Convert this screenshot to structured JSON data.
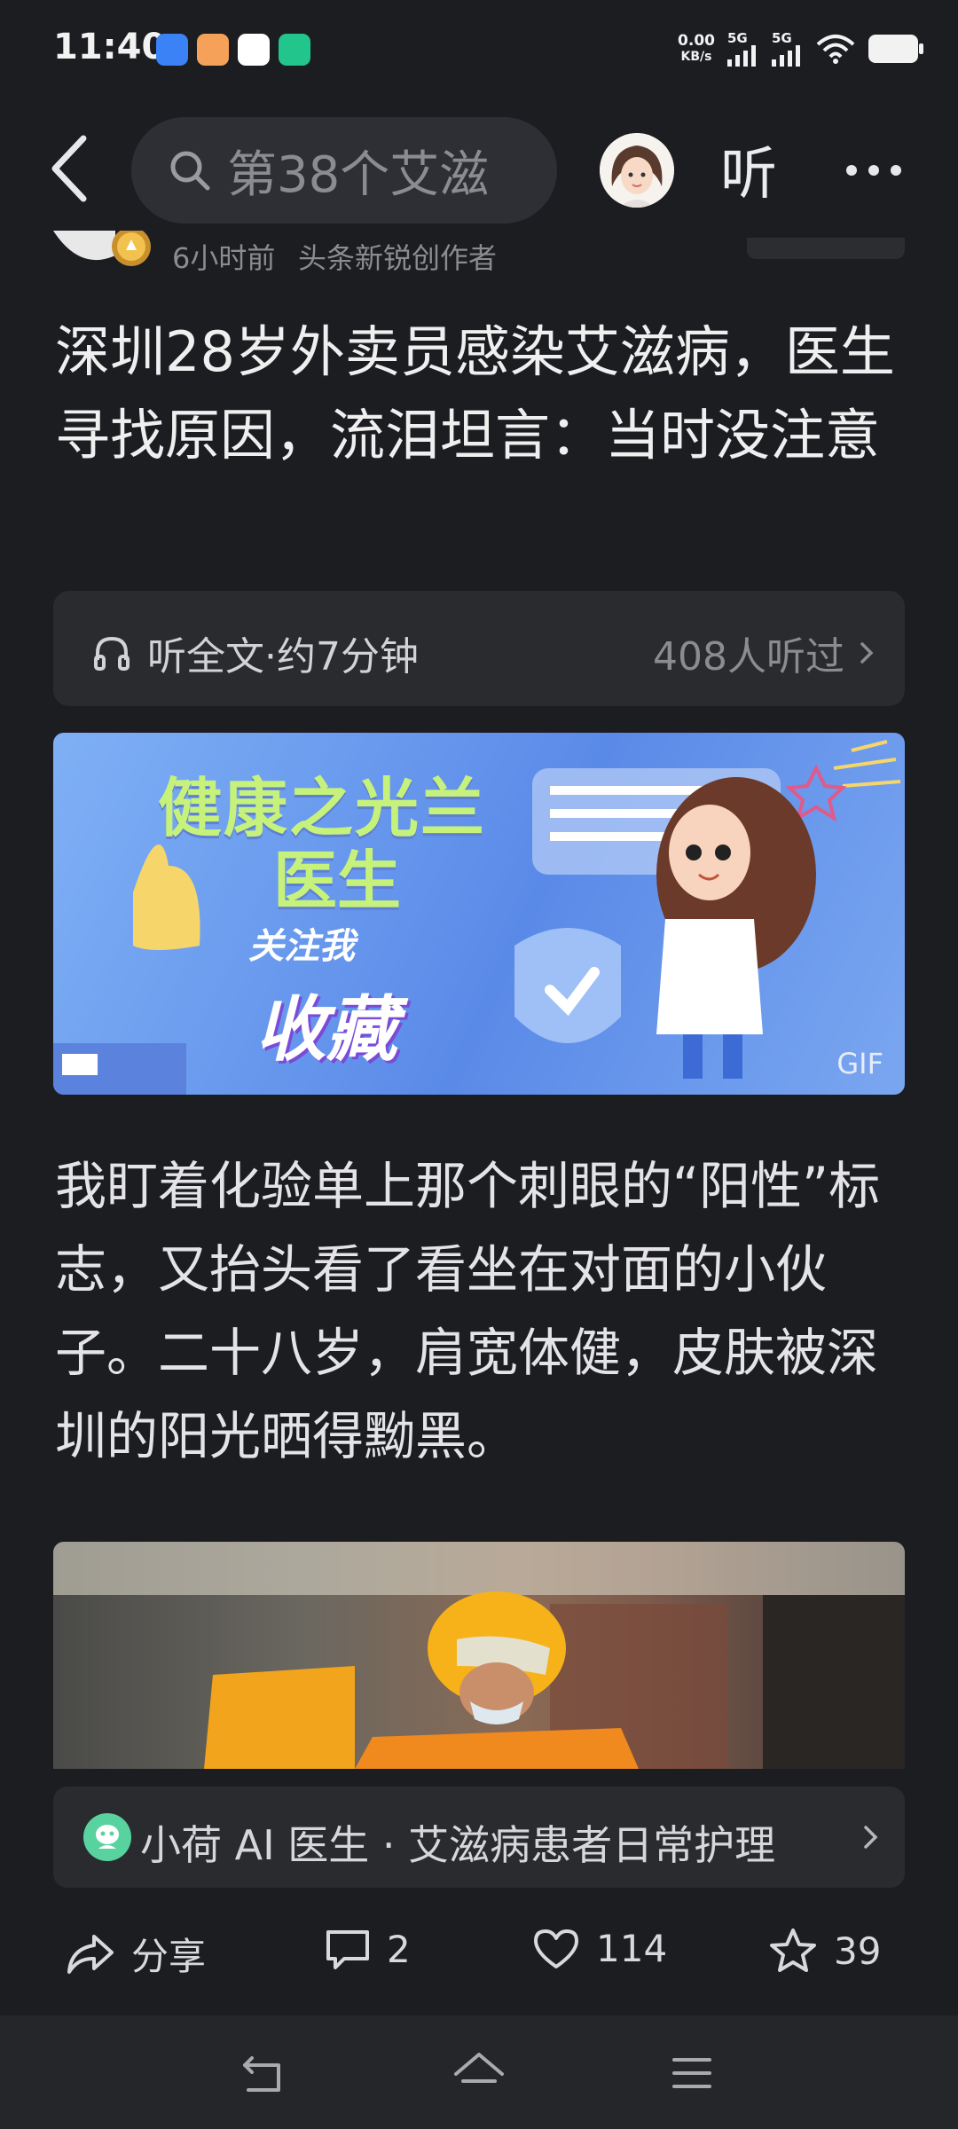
{
  "status_bar": {
    "time": "11:40",
    "net_speed_value": "0.00",
    "net_speed_unit": "KB/s",
    "signal1_label": "5G",
    "signal2_label": "5G"
  },
  "header": {
    "search_text": "第38个艾滋",
    "listen_label": "听"
  },
  "article": {
    "time_ago": "6小时前",
    "author_tag": "头条新锐创作者",
    "title": "深圳28岁外卖员感染艾滋病，医生寻找原因，流泪坦言：当时没注意",
    "audio": {
      "label": "听全文·约7分钟",
      "listeners": "408人听过"
    },
    "banner": {
      "line1": "健康之光兰",
      "line2": "医生",
      "follow": "关注我",
      "collect": "收藏",
      "badge": "GIF"
    },
    "paragraph": "我盯着化验单上那个刺眼的“阳性”标志，又抬头看了看坐在对面的小伙子。二十八岁，肩宽体健，皮肤被深圳的阳光晒得黝黑。",
    "ai_card_text": "小荷 AI 医生 · 艾滋病患者日常护理"
  },
  "actions": {
    "share_label": "分享",
    "comment_count": "2",
    "like_count": "114",
    "favorite_count": "39"
  }
}
